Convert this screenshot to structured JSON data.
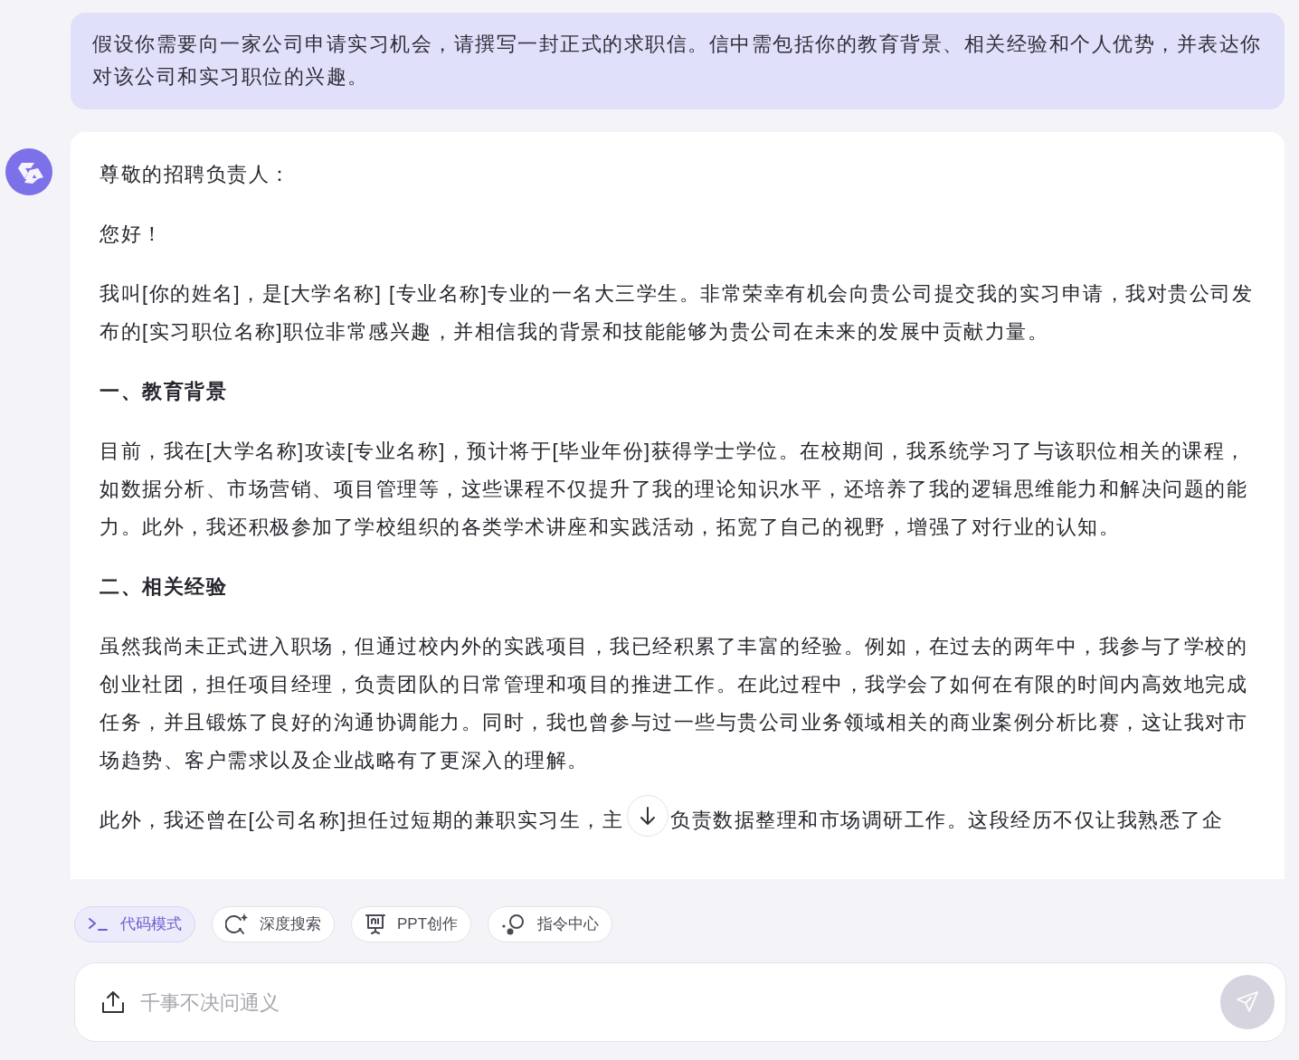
{
  "messages": [
    {
      "kind": "user",
      "paragraphs": [
        {
          "kind": "text",
          "parts": [
            "假设你需要向一家公司申请实习机会，请撰写一封正式的求职信。信中需包括你的教育背景、相关经验和个人优势，并表达你对该公司和实习职位的兴趣。"
          ]
        }
      ]
    },
    {
      "kind": "assistant",
      "paragraphs": [
        {
          "kind": "text",
          "parts": [
            "尊敬的招聘负责人："
          ]
        },
        {
          "kind": "text",
          "parts": [
            "您好！"
          ]
        },
        {
          "kind": "text",
          "parts": [
            "我叫[你的姓名]，是[大学名称] [专业名称]专业的一名大三学生。非常荣幸有机会向贵公司提交我的实习申请，我对贵公司发布的[实习职位名称]职位非常感兴趣，并相信我的背景和技能能够为贵公司在未来的发展中贡献力量。"
          ]
        },
        {
          "kind": "heading",
          "parts": [
            "一、教育背景"
          ]
        },
        {
          "kind": "text",
          "parts": [
            "目前，我在[大学名称]攻读[专业名称]，预计将于[毕业年份]获得学士学位。在校期间，我系统学习了与该职位相关的课程，如数据分析、市场营销、项目管理等，这些课程不仅提升了我的理论知识水平，还培养了我的逻辑思维能力和解决问题的能力。此外，我还积极参加了学校组织的各类学术讲座和实践活动，拓宽了自己的视野，增强了对行业的认知。"
          ]
        },
        {
          "kind": "heading",
          "parts": [
            "二、相关经验"
          ]
        },
        {
          "kind": "text",
          "parts": [
            "虽然我尚未正式进入职场，但通过校内外的实践项目，我已经积累了丰富的经验。例如，在过去的两年中，我参与了学校的创业社团，担任项目经理，负责团队的日常管理和项目的推进工作。在此过程中，我学会了如何在有限的时间内高效地完成任务，并且锻炼了良好的沟通协调能力。同时，我也曾参与过一些与贵公司业务领域相关的商业案例分析比赛，这让我对市场趋势、客户需求以及企业战略有了更深入的理解。"
          ]
        },
        {
          "kind": "text",
          "parts": [
            "此外，我还曾在[公司名称]担任过短期的兼职实习生，主",
            "负责数据整理和市场调研工作。这段经历不仅让我熟悉了企"
          ]
        }
      ]
    }
  ],
  "tools": [
    {
      "kind": "code",
      "label": "代码模式",
      "selected": true
    },
    {
      "kind": "search",
      "label": "深度搜索",
      "selected": false
    },
    {
      "kind": "ppt",
      "label": "PPT创作",
      "selected": false
    },
    {
      "kind": "prompt",
      "label": "指令中心",
      "selected": false
    }
  ],
  "input": {
    "placeholder": "千事不决问通义"
  }
}
